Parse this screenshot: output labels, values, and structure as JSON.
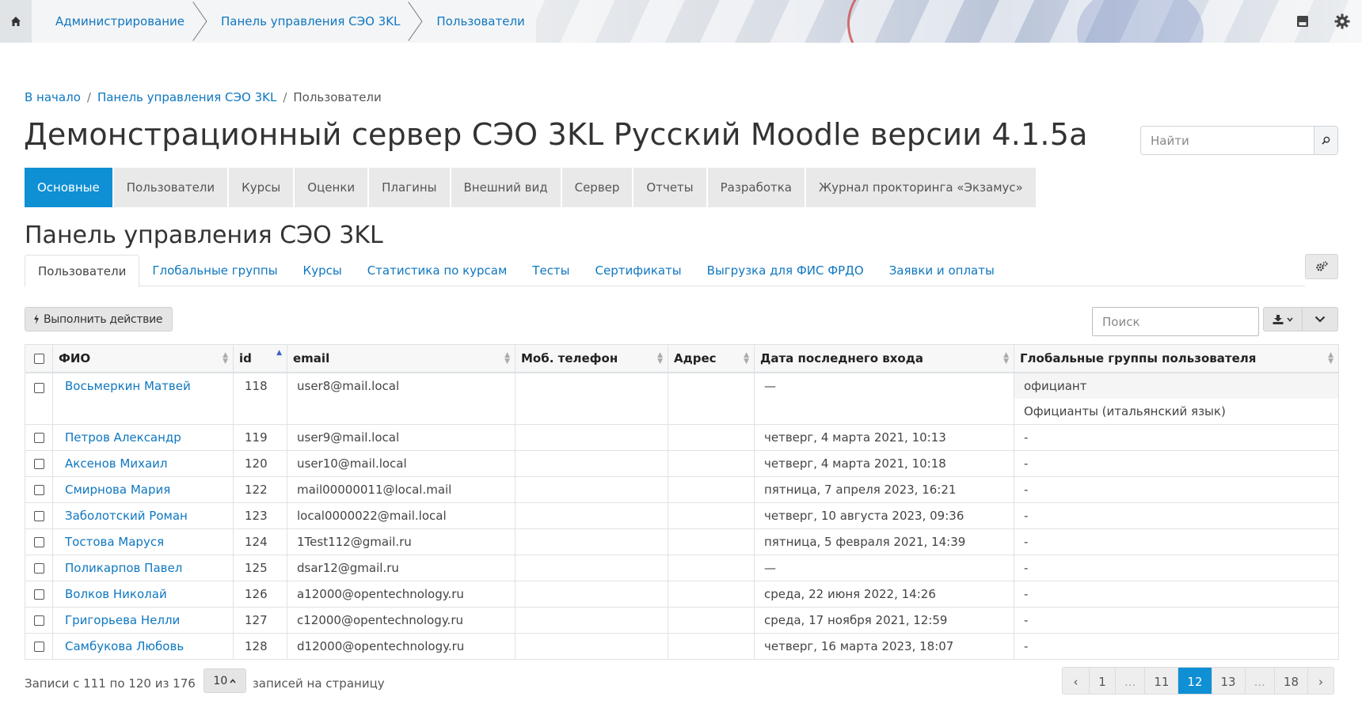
{
  "topbar": {
    "crumbs": [
      "Администрирование",
      "Панель управления СЭО 3KL",
      "Пользователи"
    ],
    "icons": [
      "home-icon",
      "save-icon",
      "gear-icon"
    ]
  },
  "breadcrumb": {
    "items": [
      "В начало",
      "Панель управления СЭО 3KL",
      "Пользователи"
    ],
    "separator": "/"
  },
  "page_title": "Демонстрационный сервер СЭО 3KL Русский Moodle версии 4.1.5a",
  "site_search": {
    "placeholder": "Найти"
  },
  "main_tabs": [
    "Основные",
    "Пользователи",
    "Курсы",
    "Оценки",
    "Плагины",
    "Внешний вид",
    "Сервер",
    "Отчеты",
    "Разработка",
    "Журнал прокторинга «Экзамус»"
  ],
  "section_title": "Панель управления СЭО 3KL",
  "sub_tabs": [
    "Пользователи",
    "Глобальные группы",
    "Курсы",
    "Статистика по курсам",
    "Тесты",
    "Сертификаты",
    "Выгрузка для ФИС ФРДО",
    "Заявки и оплаты"
  ],
  "action_button": "Выполнить действие",
  "table_search": {
    "placeholder": "Поиск"
  },
  "table": {
    "columns": [
      "ФИО",
      "id",
      "email",
      "Моб. телефон",
      "Адрес",
      "Дата последнего входа",
      "Глобальные группы пользователя"
    ],
    "rows": [
      {
        "name": "Восьмеркин Матвей",
        "id": "118",
        "email": "user8@mail.local",
        "phone": "",
        "address": "",
        "last_login": "—",
        "groups": [
          "официант",
          "Официанты (итальянский язык)"
        ]
      },
      {
        "name": "Петров Александр",
        "id": "119",
        "email": "user9@mail.local",
        "phone": "",
        "address": "",
        "last_login": "четверг, 4 марта 2021, 10:13",
        "groups": [
          "-"
        ]
      },
      {
        "name": "Аксенов Михаил",
        "id": "120",
        "email": "user10@mail.local",
        "phone": "",
        "address": "",
        "last_login": "четверг, 4 марта 2021, 10:18",
        "groups": [
          "-"
        ]
      },
      {
        "name": "Смирнова Мария",
        "id": "122",
        "email": "mail00000011@local.mail",
        "phone": "",
        "address": "",
        "last_login": "пятница, 7 апреля 2023, 16:21",
        "groups": [
          "-"
        ]
      },
      {
        "name": "Заболотский Роман",
        "id": "123",
        "email": "local0000022@mail.local",
        "phone": "",
        "address": "",
        "last_login": "четверг, 10 августа 2023, 09:36",
        "groups": [
          "-"
        ]
      },
      {
        "name": "Тостова Маруся",
        "id": "124",
        "email": "1Test112@gmail.ru",
        "phone": "",
        "address": "",
        "last_login": "пятница, 5 февраля 2021, 14:39",
        "groups": [
          "-"
        ]
      },
      {
        "name": "Поликарпов Павел",
        "id": "125",
        "email": "dsar12@gmail.ru",
        "phone": "",
        "address": "",
        "last_login": "—",
        "groups": [
          "-"
        ]
      },
      {
        "name": "Волков Николай",
        "id": "126",
        "email": "a12000@opentechnology.ru",
        "phone": "",
        "address": "",
        "last_login": "среда, 22 июня 2022, 14:26",
        "groups": [
          "-"
        ]
      },
      {
        "name": "Григорьева Нелли",
        "id": "127",
        "email": "c12000@opentechnology.ru",
        "phone": "",
        "address": "",
        "last_login": "среда, 17 ноября 2021, 12:59",
        "groups": [
          "-"
        ]
      },
      {
        "name": "Самбукова Любовь",
        "id": "128",
        "email": "d12000@opentechnology.ru",
        "phone": "",
        "address": "",
        "last_login": "четверг, 16 марта 2023, 18:07",
        "groups": [
          "-"
        ]
      }
    ]
  },
  "footer": {
    "records_text": "Записи с 111 по 120 из 176",
    "per_page_value": "10",
    "per_page_label": "записей на страницу"
  },
  "pagination": {
    "items": [
      "‹",
      "1",
      "...",
      "11",
      "12",
      "13",
      "...",
      "18",
      "›"
    ],
    "active": "12"
  },
  "colors": {
    "accent": "#0f8fd4",
    "link": "#0f77c0",
    "tab_bg": "#e9e9e9"
  }
}
